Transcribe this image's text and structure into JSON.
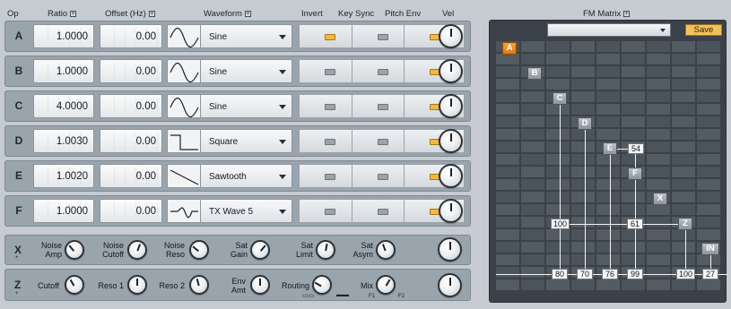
{
  "header": {
    "op": "Op",
    "ratio": "Ratio",
    "offset": "Offset (Hz)",
    "waveform": "Waveform",
    "invert": "Invert",
    "key_sync": "Key Sync",
    "pitch_env": "Pitch Env",
    "vel": "Vel",
    "fm_matrix": "FM Matrix",
    "plus": "+"
  },
  "operators": [
    {
      "label": "A",
      "ratio": "1.0000",
      "offset": "0.00",
      "waveform": "Sine",
      "invert": true,
      "key_sync": false,
      "pitch_env": true
    },
    {
      "label": "B",
      "ratio": "1.0000",
      "offset": "0.00",
      "waveform": "Sine",
      "invert": false,
      "key_sync": false,
      "pitch_env": true
    },
    {
      "label": "C",
      "ratio": "4.0000",
      "offset": "0.00",
      "waveform": "Sine",
      "invert": false,
      "key_sync": false,
      "pitch_env": true
    },
    {
      "label": "D",
      "ratio": "1.0030",
      "offset": "0.00",
      "waveform": "Square",
      "invert": false,
      "key_sync": false,
      "pitch_env": true
    },
    {
      "label": "E",
      "ratio": "1.0020",
      "offset": "0.00",
      "waveform": "Sawtooth",
      "invert": false,
      "key_sync": false,
      "pitch_env": true
    },
    {
      "label": "F",
      "ratio": "1.0000",
      "offset": "0.00",
      "waveform": "TX Wave 5",
      "invert": false,
      "key_sync": false,
      "pitch_env": true
    }
  ],
  "x_panel": {
    "label": "X",
    "plus": "+",
    "noise_amp": "Noise\nAmp",
    "noise_cutoff": "Noise\nCutoff",
    "noise_reso": "Noise\nReso",
    "sat_gain": "Sat\nGain",
    "sat_limit": "Sat\nLimit",
    "sat_asym": "Sat\nAsym"
  },
  "z_panel": {
    "label": "Z",
    "plus": "+",
    "cutoff": "Cutoff",
    "reso1": "Reso 1",
    "reso2": "Reso 2",
    "env_amt": "Env\nAmt",
    "routing": "Routing",
    "mix": "Mix",
    "f1": "F1",
    "f2": "F2"
  },
  "fm_matrix": {
    "save": "Save",
    "ops": [
      "A",
      "B",
      "C",
      "D",
      "E",
      "F",
      "X",
      "Z",
      "IN"
    ],
    "values": {
      "e_from_f": "54",
      "c_to_z": "100",
      "f_to_z": "61",
      "out_c": "80",
      "out_d": "70",
      "out_e": "76",
      "out_f": "99",
      "out_z": "100",
      "out_in": "27"
    }
  }
}
